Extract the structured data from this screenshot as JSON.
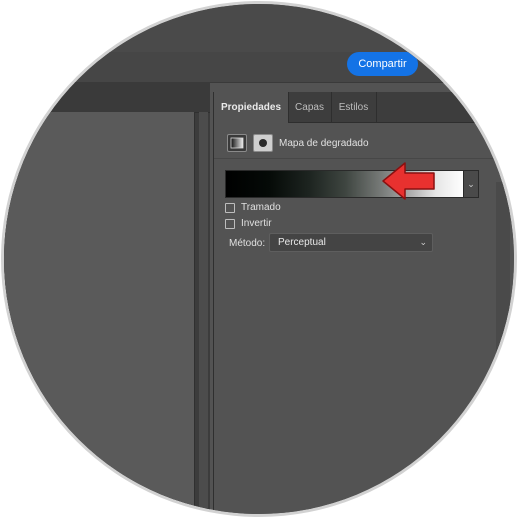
{
  "header": {
    "share_label": "Compartir"
  },
  "panel": {
    "tabs": [
      {
        "label": "Propiedades",
        "active": true
      },
      {
        "label": "Capas",
        "active": false
      },
      {
        "label": "Estilos",
        "active": false
      }
    ],
    "adjustment_label": "Mapa de degradado",
    "dither_label": "Tramado",
    "reverse_label": "Invertir",
    "method_label": "Método:",
    "method_value": "Perceptual"
  },
  "icons": {
    "gradient_map": "gradient-map-icon",
    "mask": "mask-icon",
    "dropdown": "chevron-down-icon",
    "arrow": "red-arrow-icon"
  },
  "colors": {
    "accent": "#1473e6",
    "panel_bg": "#535353",
    "arrow": "#e8312f"
  }
}
